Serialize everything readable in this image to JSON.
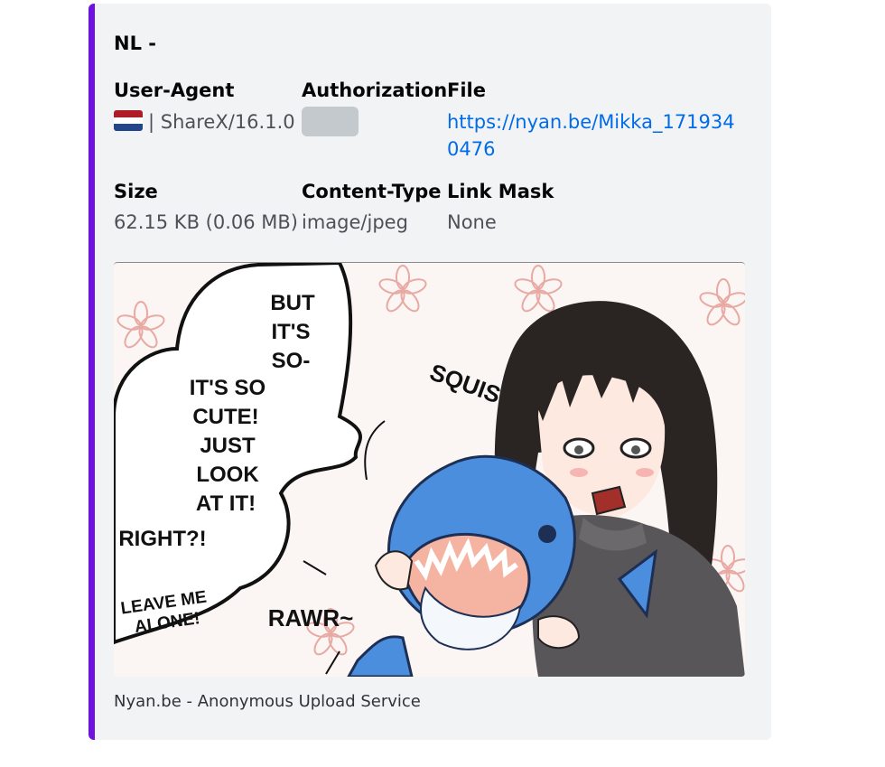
{
  "embed": {
    "accent_color": "#6f12e0",
    "author": "NL -",
    "fields": {
      "user_agent": {
        "name": "User-Agent",
        "flag": "netherlands-flag-icon",
        "value": "| ShareX/16.1.0"
      },
      "authorization": {
        "name": "Authorization",
        "value_hidden": true
      },
      "file": {
        "name": "File",
        "value": "https://nyan.be/Mikka_1719340476"
      },
      "size": {
        "name": "Size",
        "value": "62.15 KB (0.06 MB)"
      },
      "content_type": {
        "name": "Content-Type",
        "value": "image/jpeg"
      },
      "link_mask": {
        "name": "Link Mask",
        "value": "None"
      }
    },
    "image": {
      "comic_text": {
        "bubble1": [
          "BUT",
          "IT'S",
          "SO-"
        ],
        "bubble2": [
          "IT'S SO",
          "CUTE!",
          "JUST",
          "LOOK",
          "AT IT!"
        ],
        "right": "RIGHT?!",
        "leave": [
          "LEAVE ME",
          "ALONE!"
        ],
        "squish": "SQUISH",
        "rawr": "RAWR~"
      }
    },
    "footer": "Nyan.be - Anonymous Upload Service"
  }
}
